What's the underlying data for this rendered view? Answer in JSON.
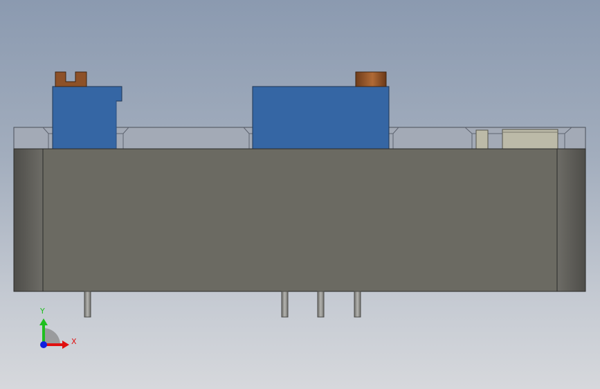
{
  "viewport": {
    "background_top": "#8b9ab0",
    "background_bottom": "#d6d8dc"
  },
  "model": {
    "body_color": "#6b6a62",
    "end_cap_color": "#5a5954",
    "top_glass_color": "#a3aab6",
    "relay_color": "#3566a4",
    "terminal_color": "#8d5128",
    "label_color": "#bcbaa8",
    "pin_color": "#8e8e8a"
  },
  "triad": {
    "x_label": "X",
    "y_label": "Y",
    "x_color": "#e01010",
    "y_color": "#1fbf1f",
    "z_color": "#1020e0"
  }
}
